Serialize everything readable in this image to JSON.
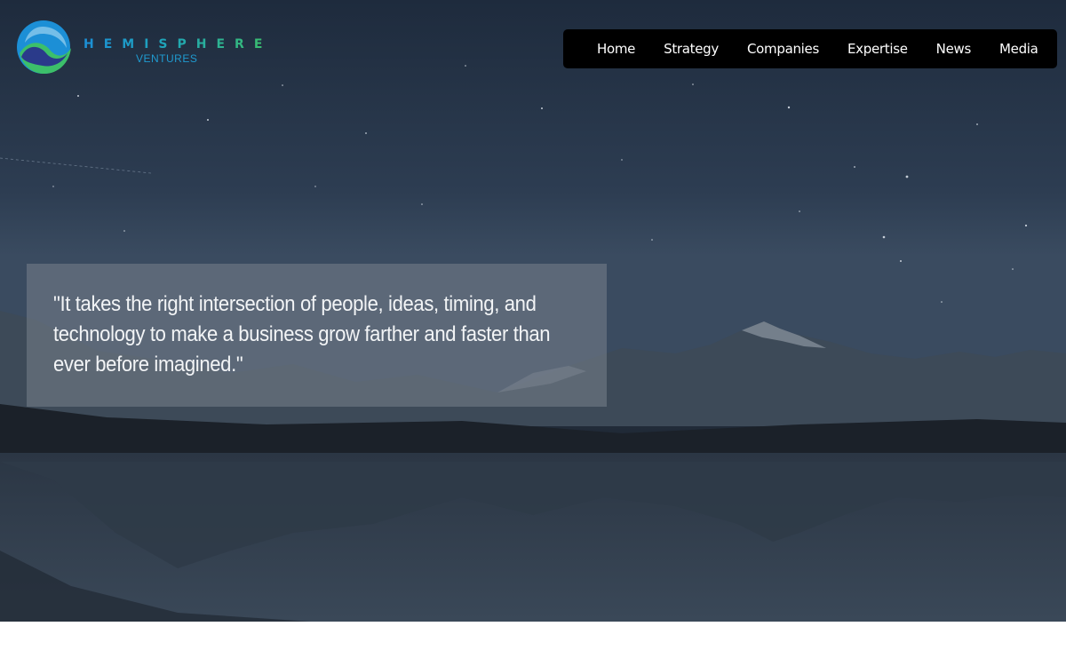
{
  "brand": {
    "name": "HEMISPHERE",
    "sub": "VENTURES",
    "logo_icon": "hemisphere-globe-logo",
    "colors": {
      "blue": "#1c8fd6",
      "navy": "#2a3a8a",
      "green": "#3cbf6a"
    }
  },
  "nav": {
    "items": [
      {
        "label": "Home"
      },
      {
        "label": "Strategy"
      },
      {
        "label": "Companies"
      },
      {
        "label": "Expertise"
      },
      {
        "label": "News"
      },
      {
        "label": "Media"
      }
    ]
  },
  "hero": {
    "quote": "\"It takes the right intersection of people, ideas, timing, and technology to make a business grow farther and faster than ever before imagined.\"",
    "background": "starry-night-mountain-lake"
  }
}
